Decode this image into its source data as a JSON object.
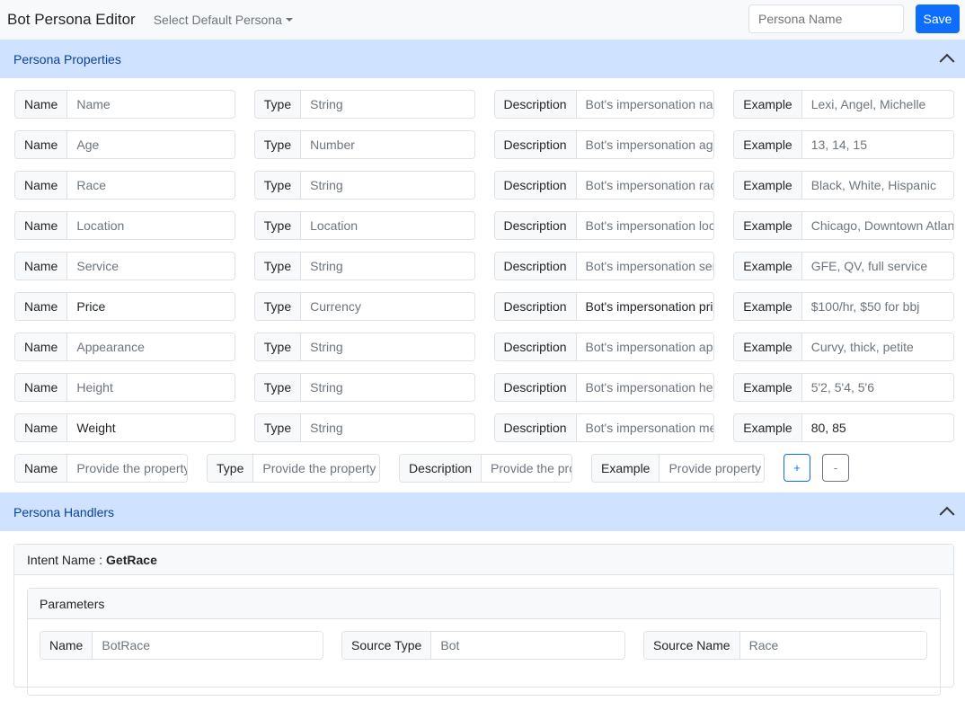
{
  "nav": {
    "title": "Bot Persona Editor",
    "persona_dropdown": "Select Default Persona",
    "persona_name_placeholder": "Persona Name",
    "save": "Save"
  },
  "properties": {
    "title": "Persona Properties",
    "labels": {
      "name": "Name",
      "type": "Type",
      "description": "Description",
      "example": "Example"
    },
    "rows": [
      {
        "name": {
          "placeholder": "Name"
        },
        "type": {
          "placeholder": "String"
        },
        "description": {
          "placeholder": "Bot's impersonation name"
        },
        "example": {
          "placeholder": "Lexi, Angel, Michelle"
        }
      },
      {
        "name": {
          "placeholder": "Age"
        },
        "type": {
          "placeholder": "Number"
        },
        "description": {
          "placeholder": "Bot's impersonation age"
        },
        "example": {
          "placeholder": "13, 14, 15"
        }
      },
      {
        "name": {
          "placeholder": "Race"
        },
        "type": {
          "placeholder": "String"
        },
        "description": {
          "placeholder": "Bot's impersonation race"
        },
        "example": {
          "placeholder": "Black, White, Hispanic"
        }
      },
      {
        "name": {
          "placeholder": "Location"
        },
        "type": {
          "placeholder": "Location"
        },
        "description": {
          "placeholder": "Bot's impersonation location"
        },
        "example": {
          "placeholder": "Chicago, Downtown Atlanta"
        }
      },
      {
        "name": {
          "placeholder": "Service"
        },
        "type": {
          "placeholder": "String"
        },
        "description": {
          "placeholder": "Bot's impersonation service"
        },
        "example": {
          "placeholder": "GFE, QV, full service"
        }
      },
      {
        "name": {
          "value": "Price"
        },
        "type": {
          "placeholder": "Currency"
        },
        "description": {
          "value": "Bot's impersonation price"
        },
        "example": {
          "placeholder": "$100/hr, $50 for bbj"
        }
      },
      {
        "name": {
          "placeholder": "Appearance"
        },
        "type": {
          "placeholder": "String"
        },
        "description": {
          "placeholder": "Bot's impersonation appearance"
        },
        "example": {
          "placeholder": "Curvy, thick, petite"
        }
      },
      {
        "name": {
          "placeholder": "Height"
        },
        "type": {
          "placeholder": "String"
        },
        "description": {
          "placeholder": "Bot's impersonation height"
        },
        "example": {
          "placeholder": "5'2, 5'4, 5'6"
        }
      },
      {
        "name": {
          "value": "Weight"
        },
        "type": {
          "placeholder": "String"
        },
        "description": {
          "placeholder": "Bot's impersonation measurements"
        },
        "example": {
          "value": "80, 85"
        }
      }
    ],
    "new_row": {
      "name": "Provide the property",
      "type": "Provide the property",
      "description": "Provide the property",
      "example": "Provide property"
    },
    "add": "+",
    "remove": "-"
  },
  "handlers": {
    "title": "Persona Handlers",
    "intent_label": "Intent Name : ",
    "intent_name": "GetRace",
    "parameters_title": "Parameters",
    "params": {
      "name_label": "Name",
      "name_placeholder": "BotRace",
      "source_type_label": "Source Type",
      "source_type_placeholder": "Bot",
      "source_name_label": "Source Name",
      "source_name_placeholder": "Race"
    }
  }
}
